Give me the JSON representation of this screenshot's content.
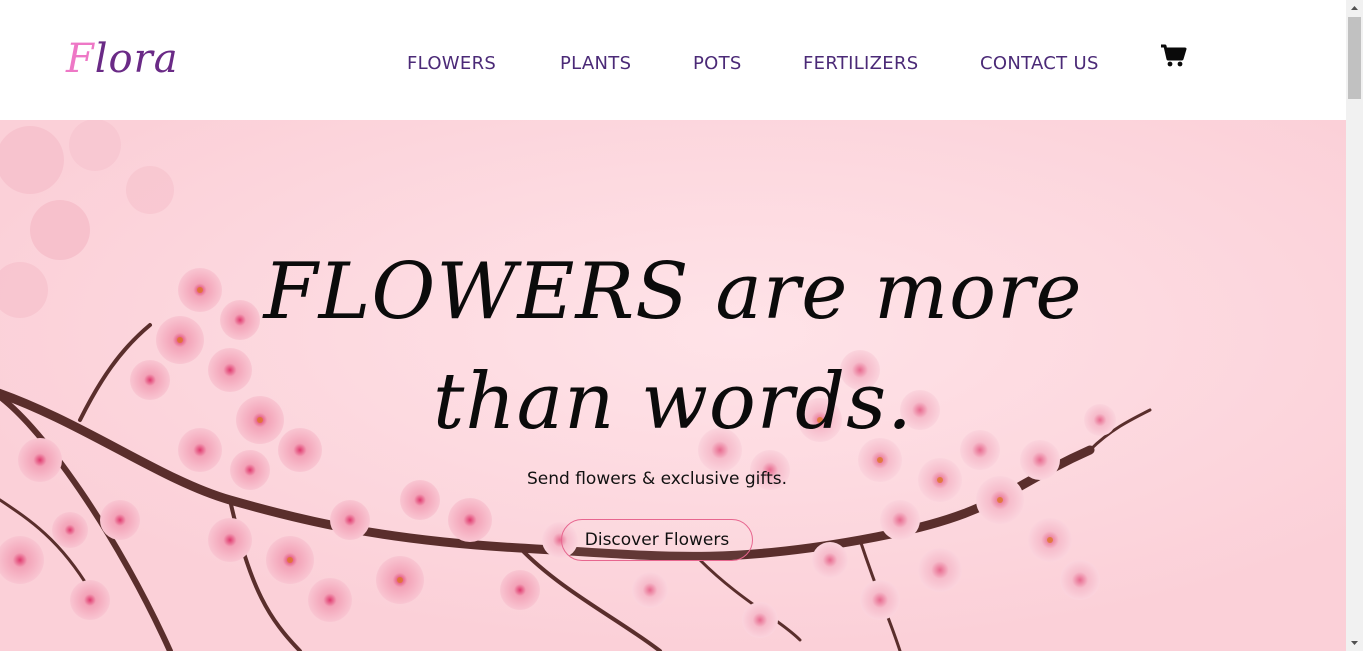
{
  "header": {
    "logo": {
      "first_letter": "F",
      "rest": "lora"
    },
    "nav": [
      {
        "label": "FLOWERS"
      },
      {
        "label": "PLANTS"
      },
      {
        "label": "POTS"
      },
      {
        "label": "FERTILIZERS"
      },
      {
        "label": "CONTACT US"
      }
    ],
    "cart_icon": "shopping-cart-icon"
  },
  "hero": {
    "headline_line1": "FLOWERS are more",
    "headline_line2": "than words.",
    "subtitle": "Send flowers & exclusive gifts.",
    "cta_label": "Discover Flowers",
    "image": "cherry-blossom-branch"
  },
  "colors": {
    "nav_text": "#4b2a77",
    "logo_pink": "#ee78c6",
    "logo_purple": "#6a2a86",
    "hero_background": "#fbd3da",
    "cta_border": "#e7668f"
  }
}
